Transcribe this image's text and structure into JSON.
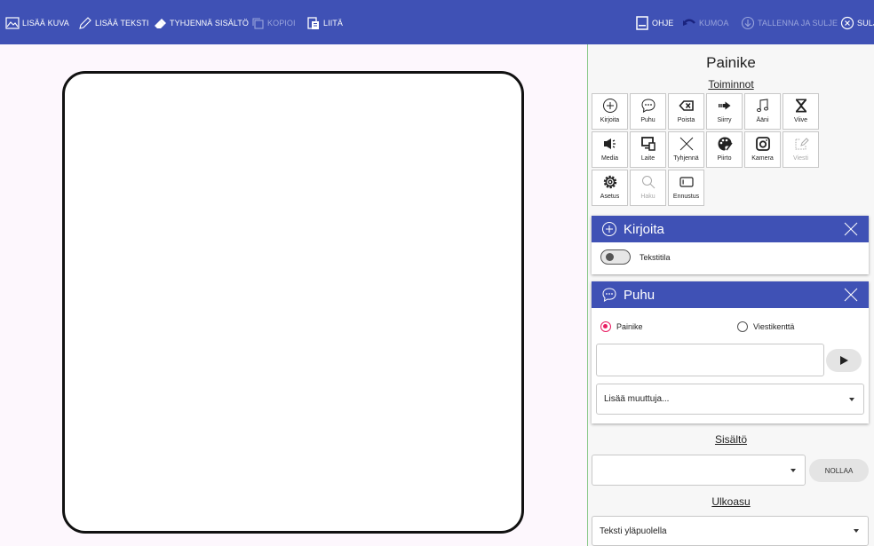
{
  "toolbar": {
    "add_image": "LISÄÄ KUVA",
    "add_text": "LISÄÄ TEKSTI",
    "clear_content": "TYHJENNÄ SISÄLTÖ",
    "copy": "KOPIOI",
    "paste": "LIITÄ",
    "help": "OHJE",
    "undo": "KUMOA",
    "save_close": "TALLENNA JA SULJE",
    "close": "SULJE"
  },
  "panel": {
    "title": "Painike",
    "actions_title": "Toiminnot",
    "actions": [
      {
        "label": "Kirjoita",
        "icon": "plus-circle-icon",
        "enabled": true
      },
      {
        "label": "Puhu",
        "icon": "speech-bubble-icon",
        "enabled": true
      },
      {
        "label": "Poista",
        "icon": "backspace-icon",
        "enabled": true
      },
      {
        "label": "Siirry",
        "icon": "arrow-right-icon",
        "enabled": true
      },
      {
        "label": "Ääni",
        "icon": "music-note-icon",
        "enabled": true
      },
      {
        "label": "Viive",
        "icon": "hourglass-icon",
        "enabled": true
      },
      {
        "label": "Media",
        "icon": "speaker-icon",
        "enabled": true
      },
      {
        "label": "Laite",
        "icon": "devices-icon",
        "enabled": true
      },
      {
        "label": "Tyhjennä",
        "icon": "x-icon",
        "enabled": true
      },
      {
        "label": "Piirto",
        "icon": "palette-icon",
        "enabled": true
      },
      {
        "label": "Kamera",
        "icon": "camera-icon",
        "enabled": true
      },
      {
        "label": "Viesti",
        "icon": "message-edit-icon",
        "enabled": false
      },
      {
        "label": "Asetus",
        "icon": "gear-icon",
        "enabled": true
      },
      {
        "label": "Haku",
        "icon": "search-icon",
        "enabled": false
      },
      {
        "label": "Ennustus",
        "icon": "prediction-icon",
        "enabled": true
      }
    ],
    "write_card": {
      "title": "Kirjoita",
      "toggle_label": "Tekstitila",
      "toggle_on": false
    },
    "speak_card": {
      "title": "Puhu",
      "radio_button": "Painike",
      "radio_field": "Viestikenttä",
      "selected": "Painike",
      "text_value": "",
      "variable_placeholder": "Lisää muuttuja..."
    },
    "content_title": "Sisältö",
    "content_select_value": "",
    "reset_label": "NOLLAA",
    "appearance_title": "Ulkoasu",
    "appearance_value": "Teksti yläpuolella"
  },
  "colors": {
    "header": "#3f51b5",
    "accent": "#e91e63",
    "background": "#fdf7fd"
  }
}
